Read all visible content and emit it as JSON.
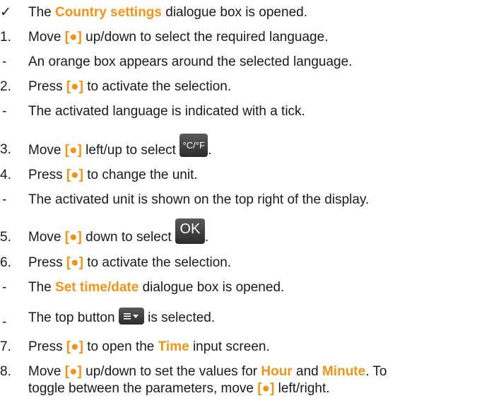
{
  "check_mark": "✓",
  "dash": "-",
  "button_symbol": "[●]",
  "steps": {
    "s0": {
      "before": "The ",
      "hl": "Country settings",
      "after": " dialogue box is opened."
    },
    "s1": {
      "num": "1.",
      "after": " up/down to select the required language.",
      "before": "Move "
    },
    "s2": {
      "text": "An orange box appears around the selected language."
    },
    "s3": {
      "num": "2.",
      "before": "Press ",
      "after": " to activate the selection."
    },
    "s4": {
      "text": "The activated language is indicated with a tick."
    },
    "s5": {
      "num": "3.",
      "before": "Move ",
      "after": " left/up to select ",
      "end": "."
    },
    "s6": {
      "num": "4.",
      "before": "Press ",
      "after": " to change the unit."
    },
    "s7": {
      "text": "The activated unit is shown on the top right of the display."
    },
    "s8": {
      "num": "5.",
      "before": "Move ",
      "after": " down to select ",
      "end": "."
    },
    "s9": {
      "num": "6.",
      "before": "Press ",
      "after": " to activate the selection."
    },
    "s10": {
      "before": "The ",
      "hl": "Set time/date",
      "after": " dialogue box is opened."
    },
    "s11": {
      "before": "The top button ",
      "after": " is selected."
    },
    "s12": {
      "num": "7.",
      "before": "Press ",
      "after": " to open the ",
      "hl": "Time",
      "end": " input screen."
    },
    "s13": {
      "num": "8.",
      "before": "Move ",
      "after": " up/down to set the values for ",
      "hl1": "Hour",
      "mid": " and ",
      "hl2": "Minute",
      "end": ". To"
    },
    "s14": {
      "before": "toggle between the parameters, move ",
      "after": " left/right."
    }
  },
  "icons": {
    "unit_button_label": "°C/°F",
    "ok_button_label": "OK",
    "menu_button": "menu-dropdown-icon"
  },
  "colors": {
    "highlight": "#f2941c",
    "text": "#1a1a1a",
    "button_bg": "#3a3a3a"
  }
}
